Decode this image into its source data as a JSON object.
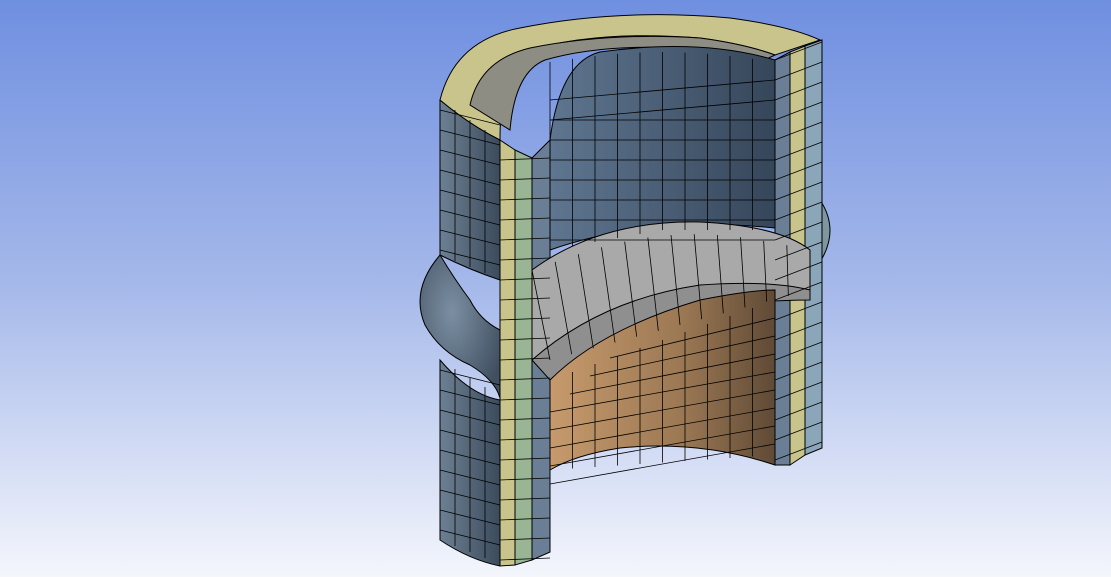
{
  "viewport": {
    "background_top": "#6f8fe0",
    "background_bottom": "#f4f6fc"
  },
  "model": {
    "description_name": "meshed-cylindrical-vessel-cutaway",
    "layer_colors": {
      "outer_yellow": "#c9c48c",
      "mid_green": "#9ab594",
      "inner_blue": "#6a7f96",
      "inner_wall": "#4a5e74",
      "floor": "#a9a9a9",
      "lower_bore": "#b48a62",
      "bulge": "#5a6c7e",
      "mesh_line": "#000000"
    }
  }
}
